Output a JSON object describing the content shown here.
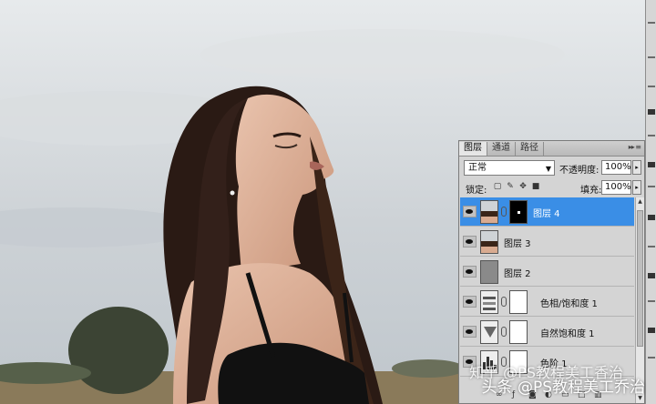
{
  "panel": {
    "tabs": [
      "图层",
      "通道",
      "路径"
    ],
    "blend_mode": "正常",
    "opacity_label": "不透明度:",
    "opacity_value": "100%",
    "lock_label": "锁定:",
    "fill_label": "填充:",
    "fill_value": "100%",
    "layers": [
      {
        "name": "图层 4",
        "selected": true,
        "icon": "photo-thumb",
        "mask": "black-mask-with-white-spot"
      },
      {
        "name": "图层 3",
        "selected": false,
        "icon": "photo-thumb"
      },
      {
        "name": "图层 2",
        "selected": false,
        "icon": "gray-fill-thumb"
      },
      {
        "name": "色相/饱和度 1",
        "selected": false,
        "icon": "hue-saturation-adjustment-icon",
        "mask": "white-mask"
      },
      {
        "name": "自然饱和度 1",
        "selected": false,
        "icon": "vibrance-adjustment-icon",
        "mask": "white-mask"
      },
      {
        "name": "色阶 1",
        "selected": false,
        "icon": "levels-adjustment-icon",
        "mask": "white-mask"
      }
    ]
  },
  "watermark": {
    "top": "知乎 @PS教程美工香治",
    "bottom": "头条 @PS教程美工乔治"
  },
  "colors": {
    "selection": "#3a8ee6",
    "panel_bg": "#d4d4d4",
    "sky": "#cdd2d6"
  }
}
